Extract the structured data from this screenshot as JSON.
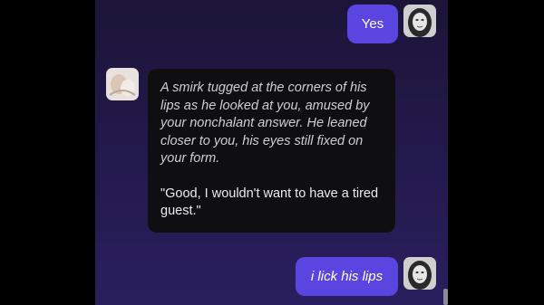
{
  "messages": [
    {
      "role": "user",
      "text": "Yes"
    },
    {
      "role": "bot",
      "narration": "A smirk tugged at the corners of his lips as he looked at you, amused by your nonchalant answer. He leaned closer to you, his eyes still fixed on your form.",
      "speech": "\"Good, I wouldn't want to have a tired guest.\""
    },
    {
      "role": "user",
      "text": "i lick his lips"
    }
  ]
}
